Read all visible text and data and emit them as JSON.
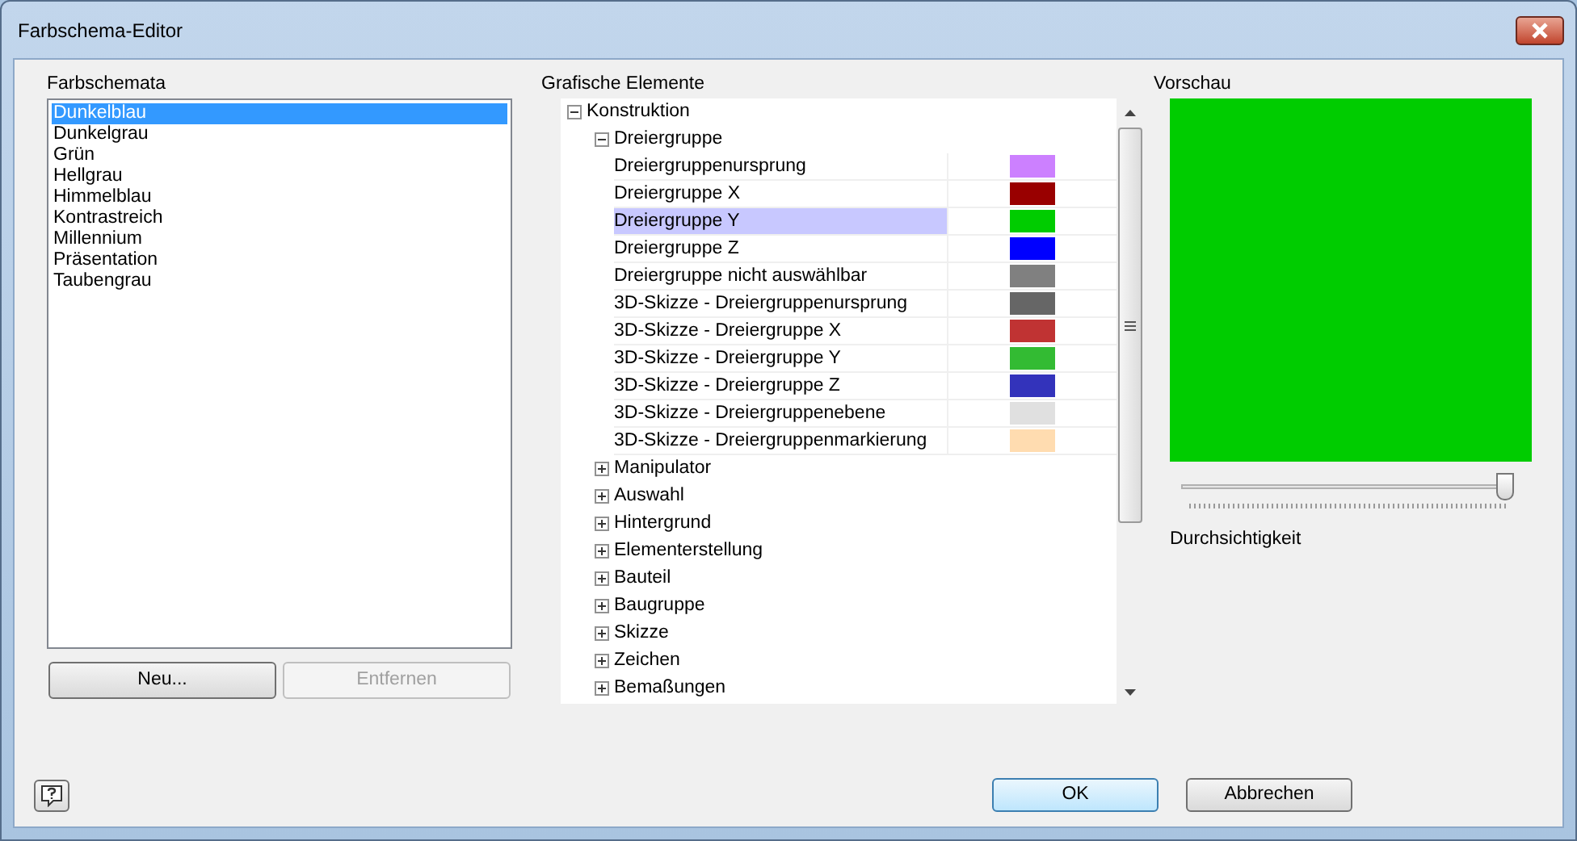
{
  "window": {
    "title": "Farbschema-Editor"
  },
  "schemes": {
    "label": "Farbschemata",
    "items": [
      {
        "label": "Dunkelblau",
        "selected": true
      },
      {
        "label": "Dunkelgrau",
        "selected": false
      },
      {
        "label": "Grün",
        "selected": false
      },
      {
        "label": "Hellgrau",
        "selected": false
      },
      {
        "label": "Himmelblau",
        "selected": false
      },
      {
        "label": "Kontrastreich",
        "selected": false
      },
      {
        "label": "Millennium",
        "selected": false
      },
      {
        "label": "Präsentation",
        "selected": false
      },
      {
        "label": "Taubengrau",
        "selected": false
      }
    ],
    "buttons": [
      {
        "label": "Neu...",
        "disabled": false
      },
      {
        "label": "Entfernen",
        "disabled": true
      }
    ]
  },
  "elements": {
    "label": "Grafische Elemente",
    "tree": [
      {
        "label": "Konstruktion",
        "expanded": true,
        "children": [
          {
            "label": "Dreiergruppe",
            "expanded": true,
            "children": [
              {
                "label": "Dreiergruppenursprung",
                "color": "#cc80ff",
                "selected": false
              },
              {
                "label": "Dreiergruppe X",
                "color": "#990000",
                "selected": false
              },
              {
                "label": "Dreiergruppe Y",
                "color": "#00cc00",
                "selected": true
              },
              {
                "label": "Dreiergruppe Z",
                "color": "#0000ff",
                "selected": false
              },
              {
                "label": "Dreiergruppe nicht auswählbar",
                "color": "#808080",
                "selected": false
              },
              {
                "label": "3D-Skizze - Dreiergruppenursprung",
                "color": "#666666",
                "selected": false
              },
              {
                "label": "3D-Skizze - Dreiergruppe X",
                "color": "#c03333",
                "selected": false
              },
              {
                "label": "3D-Skizze - Dreiergruppe Y",
                "color": "#33bb33",
                "selected": false
              },
              {
                "label": "3D-Skizze - Dreiergruppe Z",
                "color": "#3333bb",
                "selected": false
              },
              {
                "label": "3D-Skizze - Dreiergruppenebene",
                "color": "#e0e0e0",
                "selected": false
              },
              {
                "label": "3D-Skizze - Dreiergruppenmarkierung",
                "color": "#ffdcb0",
                "selected": false
              }
            ]
          },
          {
            "label": "Manipulator",
            "expanded": false
          },
          {
            "label": "Auswahl",
            "expanded": false
          },
          {
            "label": "Hintergrund",
            "expanded": false
          },
          {
            "label": "Elementerstellung",
            "expanded": false
          },
          {
            "label": "Bauteil",
            "expanded": false
          },
          {
            "label": "Baugruppe",
            "expanded": false
          },
          {
            "label": "Skizze",
            "expanded": false
          },
          {
            "label": "Zeichen",
            "expanded": false
          },
          {
            "label": "Bemaßungen",
            "expanded": false
          }
        ]
      }
    ]
  },
  "preview": {
    "label": "Vorschau",
    "color": "#00cc00",
    "transparency": {
      "label": "Durchsichtigkeit",
      "level": 1
    }
  },
  "footer": {
    "buttons": [
      {
        "label": "OK",
        "default": true
      },
      {
        "label": "Abbrechen",
        "default": false
      }
    ]
  }
}
